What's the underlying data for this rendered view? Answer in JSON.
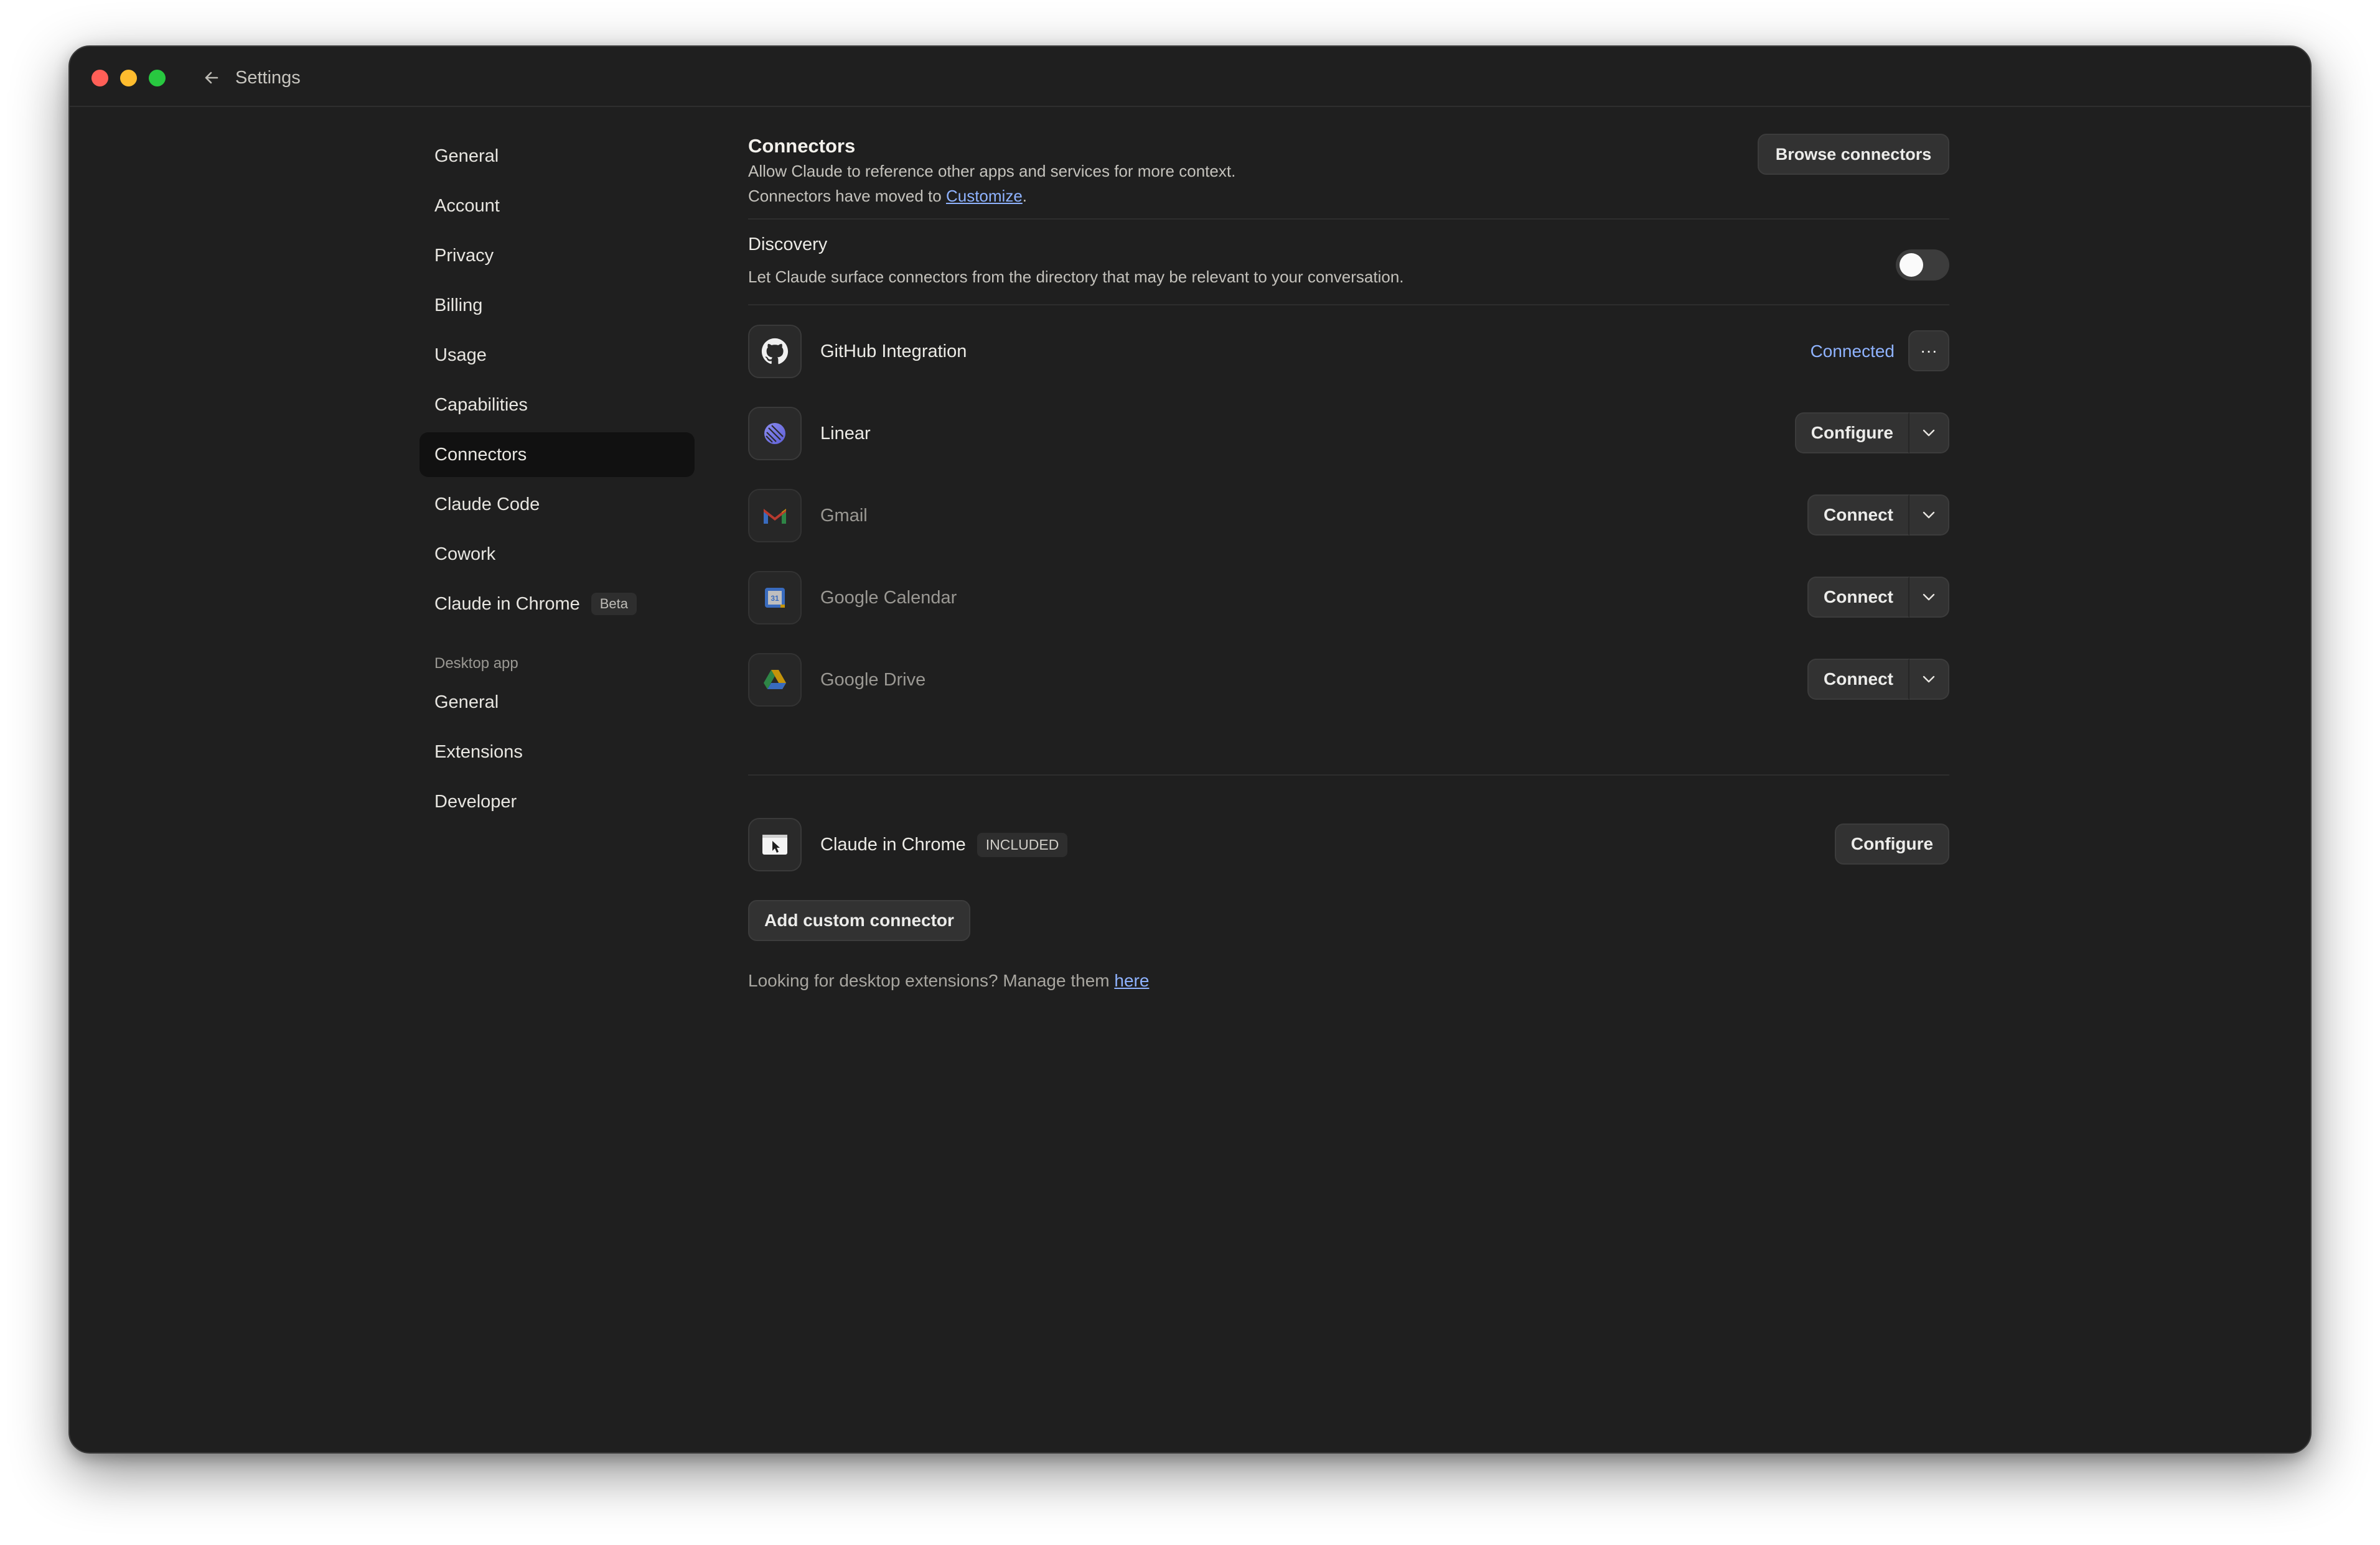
{
  "window": {
    "title": "Settings"
  },
  "sidebar": {
    "items": [
      {
        "label": "General"
      },
      {
        "label": "Account"
      },
      {
        "label": "Privacy"
      },
      {
        "label": "Billing"
      },
      {
        "label": "Usage"
      },
      {
        "label": "Capabilities"
      },
      {
        "label": "Connectors",
        "active": true
      },
      {
        "label": "Claude Code"
      },
      {
        "label": "Cowork"
      },
      {
        "label": "Claude in Chrome",
        "badge": "Beta"
      }
    ],
    "desktop_section": "Desktop app",
    "desktop_items": [
      {
        "label": "General"
      },
      {
        "label": "Extensions"
      },
      {
        "label": "Developer"
      }
    ]
  },
  "header": {
    "title": "Connectors",
    "description": "Allow Claude to reference other apps and services for more context.",
    "moved_prefix": "Connectors have moved to ",
    "moved_link": "Customize",
    "moved_suffix": ".",
    "browse_button": "Browse connectors"
  },
  "discovery": {
    "title": "Discovery",
    "description": "Let Claude surface connectors from the directory that may be relevant to your conversation.",
    "enabled": false
  },
  "connectors": [
    {
      "name": "GitHub Integration",
      "icon": "github-icon",
      "status": "Connected",
      "more": "···"
    },
    {
      "name": "Linear",
      "icon": "linear-icon",
      "action": "Configure"
    },
    {
      "name": "Gmail",
      "icon": "gmail-icon",
      "action": "Connect"
    },
    {
      "name": "Google Calendar",
      "icon": "google-calendar-icon",
      "action": "Connect",
      "icon_text": "31"
    },
    {
      "name": "Google Drive",
      "icon": "google-drive-icon",
      "action": "Connect"
    }
  ],
  "chrome": {
    "name": "Claude in Chrome",
    "badge": "INCLUDED",
    "action": "Configure"
  },
  "add_custom": "Add custom connector",
  "footer": {
    "text": "Looking for desktop extensions? Manage them ",
    "link": "here"
  },
  "colors": {
    "background": "#1f1f1f",
    "accent_link": "#8fb3ff",
    "active_nav": "#111111"
  }
}
